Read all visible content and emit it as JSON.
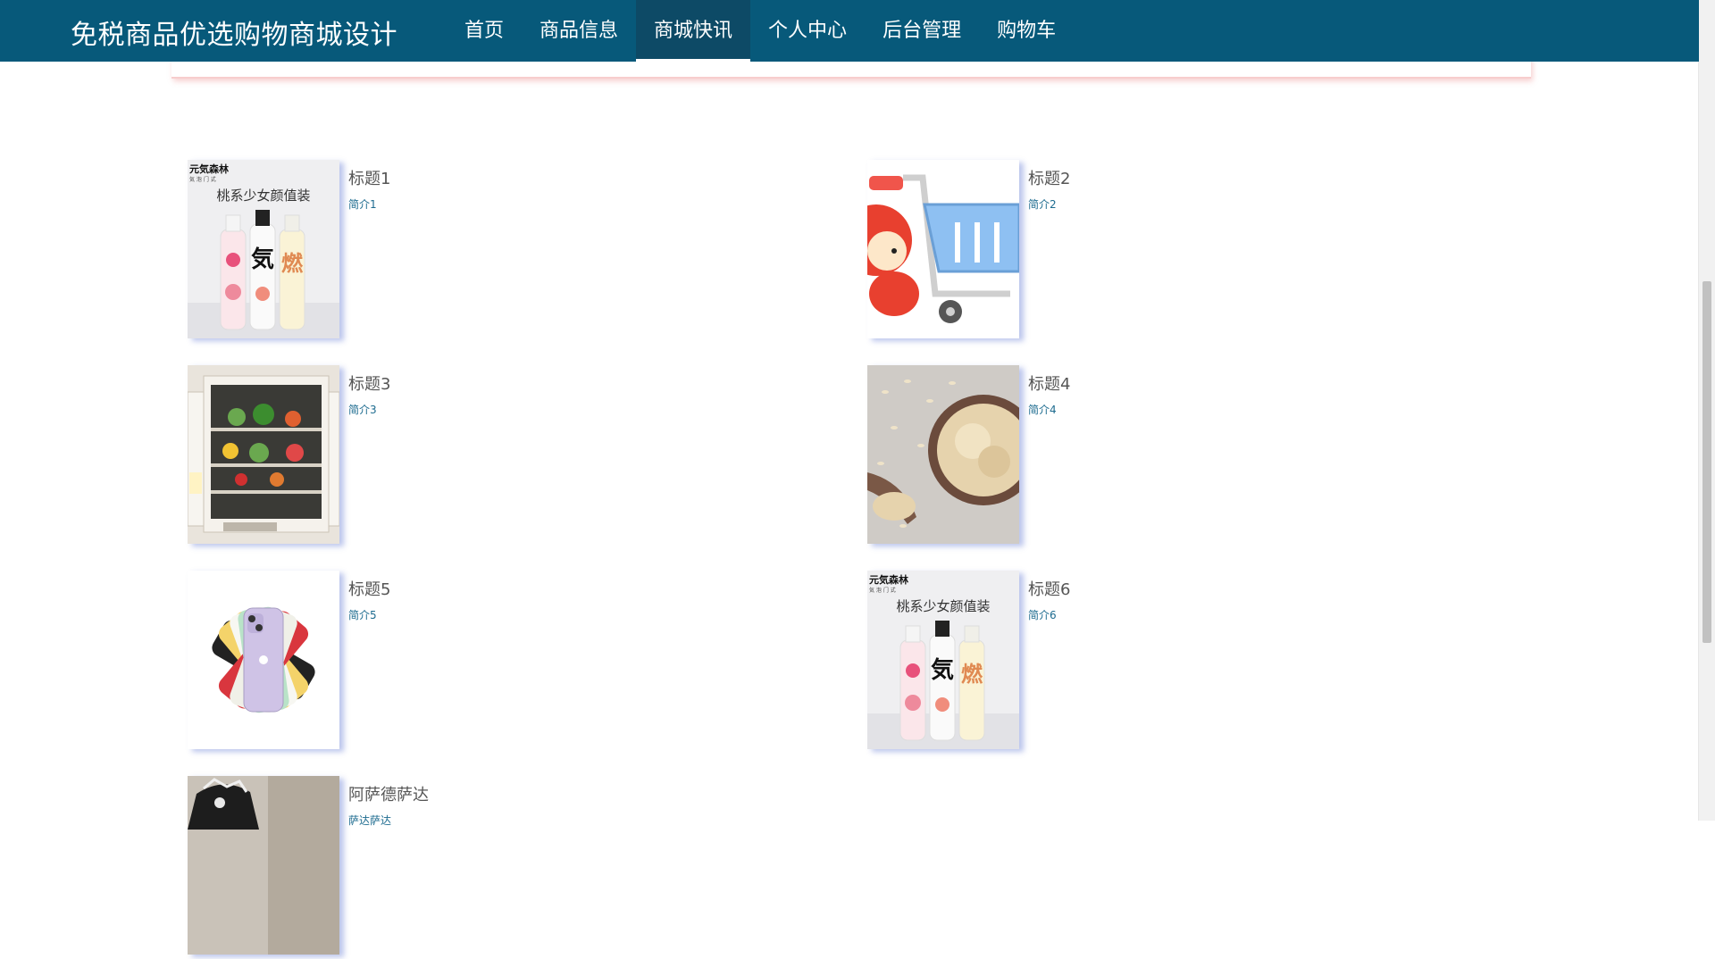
{
  "header": {
    "site_title": "免税商品优选购物商城设计",
    "nav": [
      "首页",
      "商品信息",
      "商城快讯",
      "个人中心",
      "后台管理",
      "购物车"
    ],
    "active_nav": "商城快讯"
  },
  "thumb_text": {
    "brand": "元気森林",
    "brand_sub": "気 泡 门 式",
    "slogan": "桃系少女颜值装",
    "bottle_mark": "気",
    "bottle_mark2": "燃"
  },
  "news": [
    {
      "title": "标题1",
      "desc": "简介1",
      "image": "drink-bottles"
    },
    {
      "title": "标题2",
      "desc": "简介2",
      "image": "shopping-cart-mascot"
    },
    {
      "title": "标题3",
      "desc": "简介3",
      "image": "fridge"
    },
    {
      "title": "标题4",
      "desc": "简介4",
      "image": "oats-bowl"
    },
    {
      "title": "标题5",
      "desc": "简介5",
      "image": "phone-fan"
    },
    {
      "title": "标题6",
      "desc": "简介6",
      "image": "drink-bottles"
    },
    {
      "title": "阿萨德萨达",
      "desc": "萨达萨达",
      "image": "dress-photo"
    }
  ],
  "colors": {
    "nav_bg": "#07597a",
    "nav_active_bg": "#0d4a66",
    "desc_link": "#1d6b8f",
    "title_text": "#555555"
  }
}
